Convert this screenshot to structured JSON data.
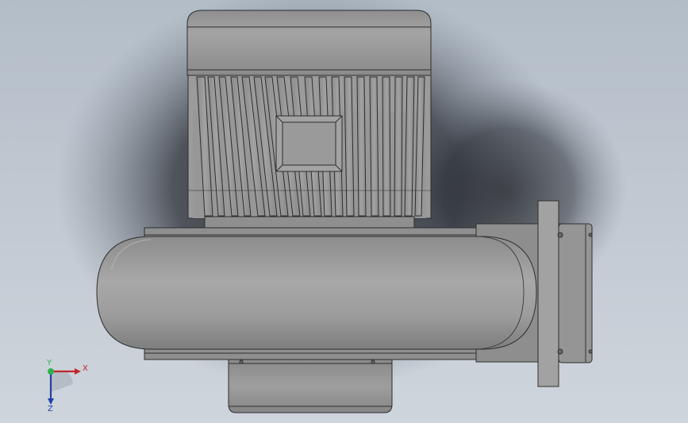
{
  "viewport": {
    "background_top": "#b3bdc8",
    "background_bottom": "#cfd5dc",
    "model_color": "#9a9a9a"
  },
  "triad": {
    "x_label": "X",
    "y_label": "Y",
    "z_label": "Z",
    "x_color": "#c0262d",
    "y_color": "#2bb34a",
    "z_color": "#1f3fa8"
  }
}
